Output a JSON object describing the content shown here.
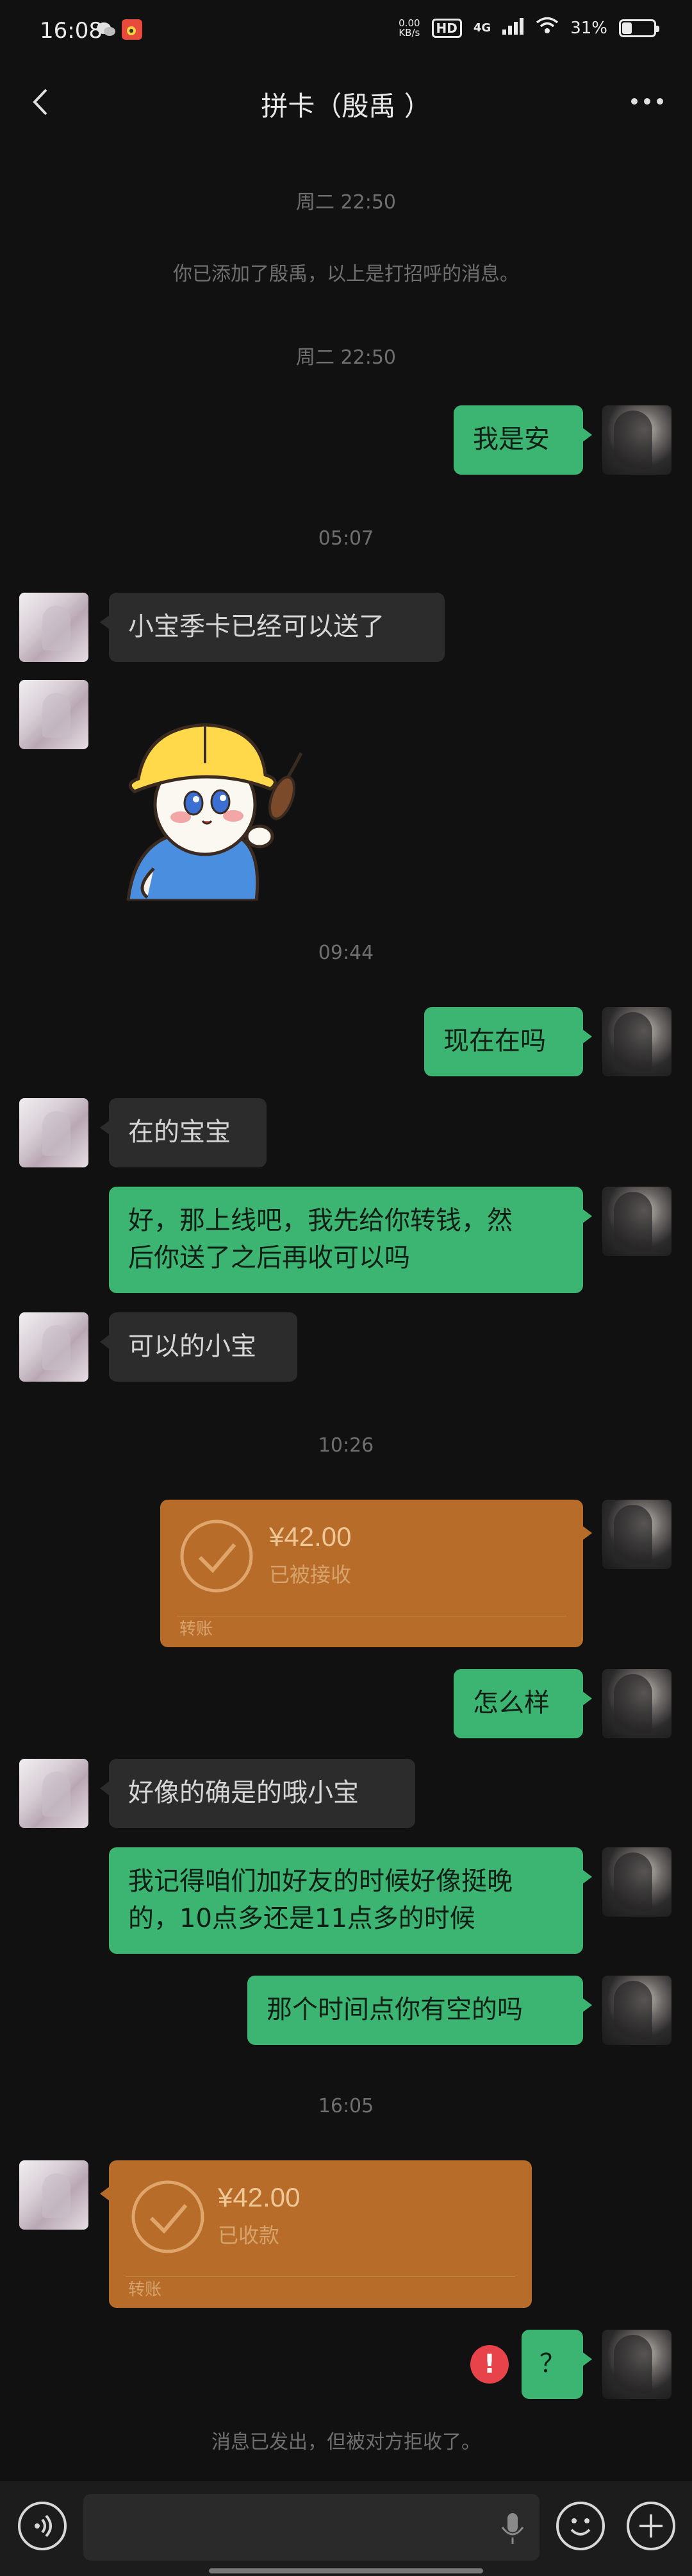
{
  "status_bar": {
    "time": "16:08",
    "net_speed": "0.00\nKB/s",
    "hd": "HD",
    "network": "4G",
    "battery": "31%",
    "battery_level": 0.31
  },
  "header": {
    "title": "拼卡（殷禹 ）"
  },
  "messages": {
    "sys1": "周二 22:50",
    "sys2": "你已添加了殷禹，以上是打招呼的消息。",
    "sys3": "周二 22:50",
    "m1": "我是安",
    "sys4": "05:07",
    "m2": "小宝季卡已经可以送了",
    "sys5": "09:44",
    "m3": "现在在吗",
    "m4": "在的宝宝",
    "m5_line1": "好，那上线吧，我先给你转钱，然",
    "m5_line2": "后你送了之后再收可以吗",
    "m6": "可以的小宝",
    "sys6": "10:26",
    "transfer1": {
      "amount": "¥42.00",
      "status": "已被接收",
      "label": "转账"
    },
    "m7": "怎么样",
    "m8": "好像的确是的哦小宝",
    "m9_line1": "我记得咱们加好友的时候好像挺晚",
    "m9_line2": "的，10点多还是11点多的时候",
    "m10": "那个时间点你有空的吗",
    "sys7": "16:05",
    "transfer2": {
      "amount": "¥42.00",
      "status": "已收款",
      "label": "转账"
    },
    "m11": "？",
    "error_mark": "!",
    "sys8": "消息已发出，但被对方拒收了。"
  },
  "colors": {
    "sent_bubble": "#3cb572",
    "received_bubble": "#2c2c2c",
    "transfer": "#b76d29",
    "background": "#111111",
    "error": "#e8434a"
  }
}
